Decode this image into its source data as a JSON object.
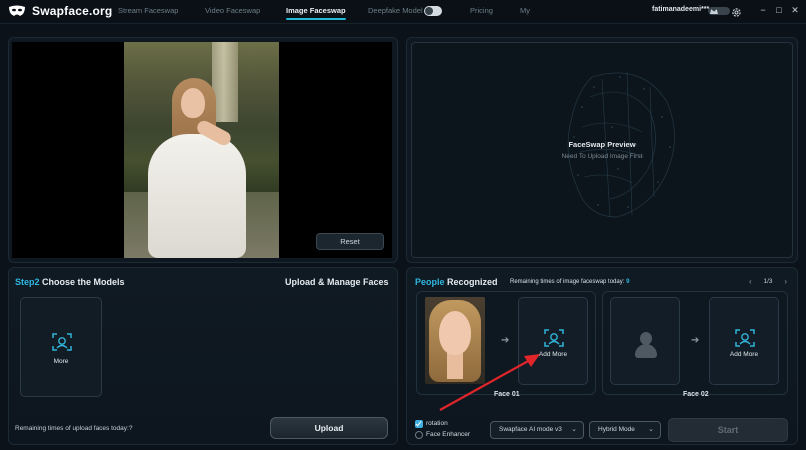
{
  "app": {
    "name": "Swapface.org",
    "user": "fatimanadeemi***",
    "window_controls": [
      "−",
      "□",
      "✕"
    ]
  },
  "nav": {
    "items": [
      {
        "label": "Stream Faceswap",
        "active": false
      },
      {
        "label": "Video Faceswap",
        "active": false
      },
      {
        "label": "Image Faceswap",
        "active": true
      },
      {
        "label": "Deepfake Model",
        "active": false
      },
      {
        "label": "Pricing",
        "active": false
      },
      {
        "label": "My",
        "active": false
      }
    ],
    "deepfake_toggle": "on"
  },
  "image_panel": {
    "reset_label": "Reset"
  },
  "preview_panel": {
    "title": "FaceSwap Preview",
    "subtitle": "Need To Upload Image First"
  },
  "models_panel": {
    "step_label": "Step2",
    "title_rest": " Choose the Models",
    "right_title": "Upload & Manage Faces",
    "more_label": "More",
    "remaining_label": "Remaining times of upload faces today:?",
    "upload_label": "Upload"
  },
  "people_panel": {
    "title_accent": "People",
    "title_rest": " Recognized",
    "remaining_label": "Remaining times of image faceswap today:",
    "remaining_value": "9",
    "pager": "1/3",
    "pager_prev": "‹",
    "pager_next": "›",
    "faces": [
      {
        "label": "Face 01",
        "add_label": "Add More"
      },
      {
        "label": "Face 02",
        "add_label": "Add More"
      }
    ],
    "options": [
      {
        "label": "rotation",
        "checked": true
      },
      {
        "label": "Face Enhancer",
        "checked": false
      }
    ],
    "mode_select": "Swapface AI mode v3",
    "hybrid_select": "Hybrid Mode",
    "start_label": "Start"
  },
  "colors": {
    "accent": "#2fb7e0",
    "annotation_arrow": "#e0262a",
    "background": "#0b1219"
  }
}
